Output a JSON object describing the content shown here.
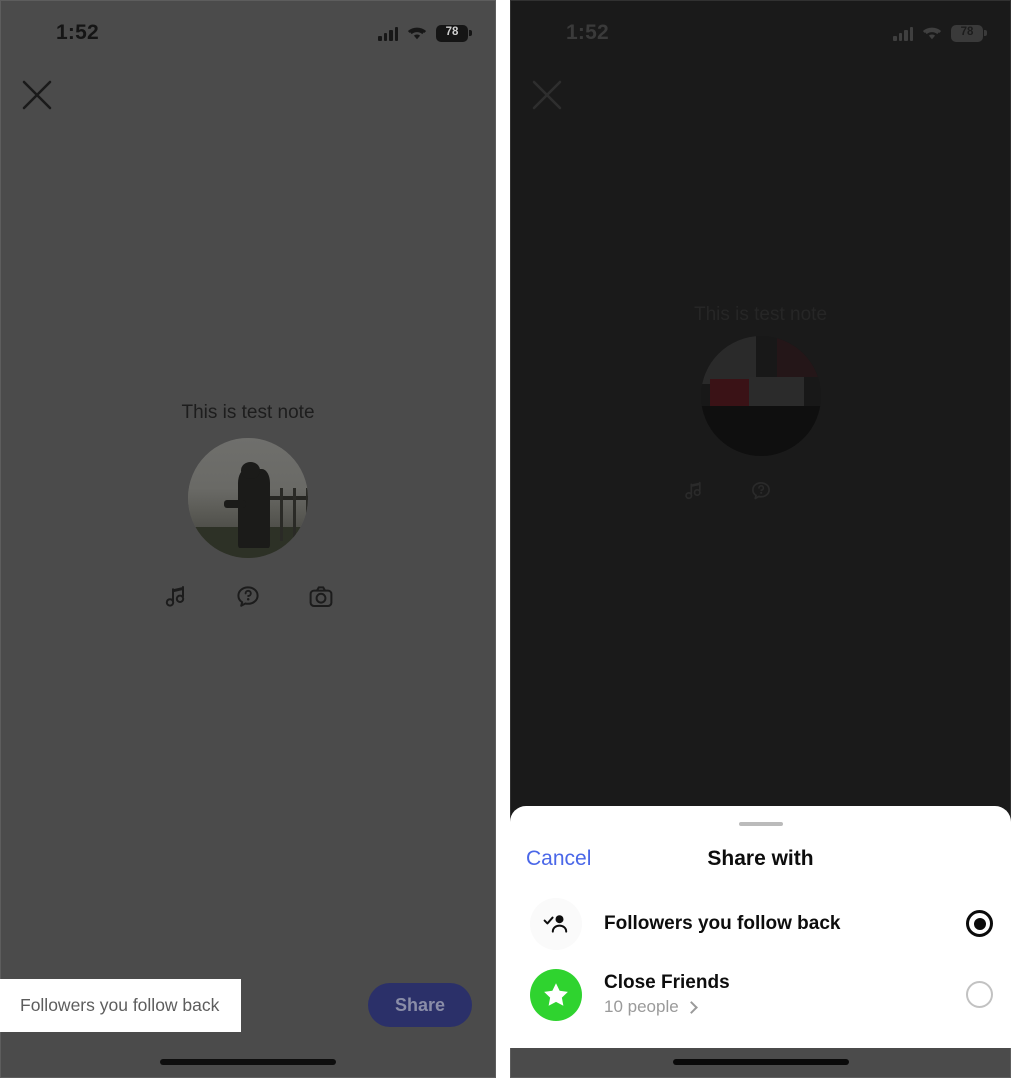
{
  "status_bar": {
    "time": "1:52",
    "battery_level": "78",
    "signal_icon": "cellular-bars-icon",
    "wifi_icon": "wifi-icon",
    "battery_icon": "battery-icon"
  },
  "left_screen": {
    "close_icon": "close-icon",
    "note": {
      "text": "This is test note",
      "avatar_alt": "user-avatar"
    },
    "note_actions": [
      {
        "name": "music-icon",
        "label": "Music"
      },
      {
        "name": "prompt-bubble-icon",
        "label": "Prompt"
      },
      {
        "name": "camera-icon",
        "label": "Camera"
      }
    ],
    "audience_callout": "Followers you follow back",
    "share_button": "Share"
  },
  "right_screen": {
    "close_icon": "close-icon",
    "note": {
      "text": "This is test note",
      "avatar_alt": "user-avatar"
    },
    "note_actions": [
      {
        "name": "music-icon",
        "label": "Music"
      },
      {
        "name": "prompt-bubble-icon",
        "label": "Prompt"
      },
      {
        "name": "camera-icon",
        "label": "Camera"
      }
    ],
    "share_sheet": {
      "handle": "drag-handle",
      "cancel_label": "Cancel",
      "title": "Share with",
      "options": [
        {
          "id": "followers-you-follow-back",
          "icon": "person-check-icon",
          "title": "Followers you follow back",
          "subtitle": "",
          "selected": true
        },
        {
          "id": "close-friends",
          "icon": "star-icon",
          "title": "Close Friends",
          "subtitle": "10 people",
          "selected": false
        }
      ]
    }
  },
  "colors": {
    "left_panel_bg": "#4b4b4b",
    "right_panel_bg": "#1a1a1a",
    "share_button_bg": "#2b3069",
    "cancel_blue": "#4a67e8",
    "close_friends_green": "#2fd32f",
    "sheet_bg": "#ffffff",
    "callout_bg": "#ffffff"
  }
}
